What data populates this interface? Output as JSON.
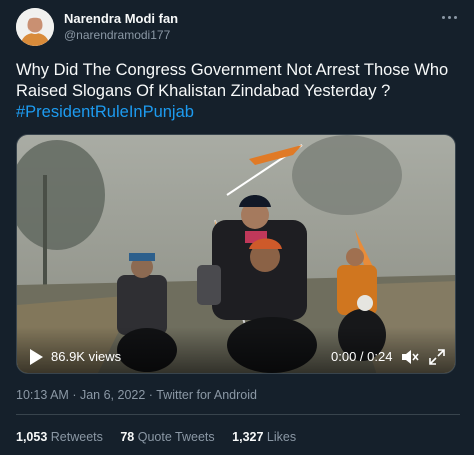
{
  "author": {
    "name": "Narendra Modi fan",
    "handle": "@narendramodi177"
  },
  "tweet": {
    "text": "Why Did The Congress Government Not Arrest Those Who Raised Slogans Of Khalistan Zindabad Yesterday ?",
    "hashtag": "#PresidentRuleInPunjab"
  },
  "video": {
    "views": "86.9K views",
    "time": "0:00 / 0:24"
  },
  "meta": {
    "time": "10:13 AM",
    "date": "Jan 6, 2022",
    "source": "Twitter for Android",
    "separator": "·"
  },
  "stats": {
    "retweets_count": "1,053",
    "retweets_label": "Retweets",
    "quotes_count": "78",
    "quotes_label": "Quote Tweets",
    "likes_count": "1,327",
    "likes_label": "Likes"
  },
  "colors": {
    "background": "#15202b",
    "text": "#f7f9f9",
    "secondary_text": "#8b98a5",
    "link": "#1d9bf0",
    "border": "#38444d"
  },
  "icons": [
    "more-icon",
    "play-icon",
    "volume-icon",
    "fullscreen-icon"
  ]
}
